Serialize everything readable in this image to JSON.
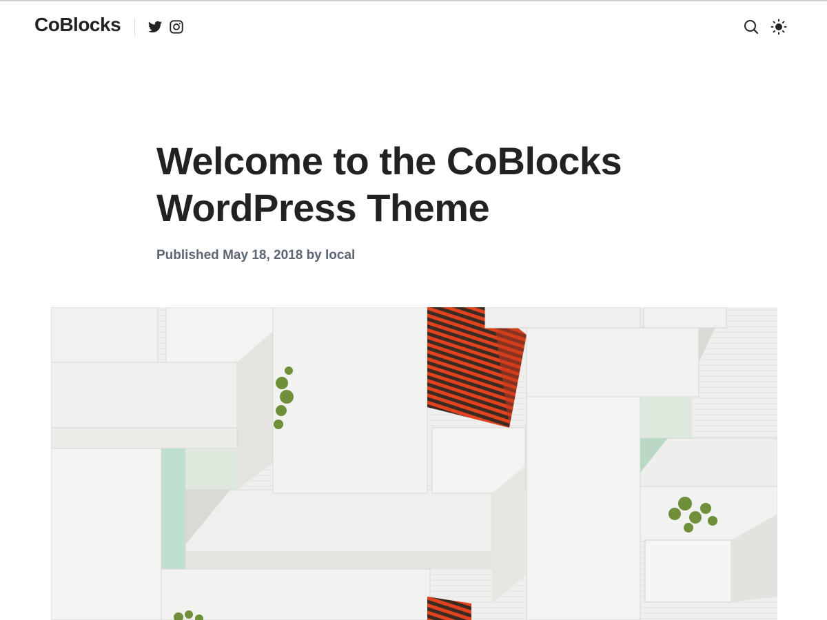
{
  "site": {
    "title": "CoBlocks",
    "social": [
      {
        "name": "twitter-icon"
      },
      {
        "name": "instagram-icon"
      }
    ]
  },
  "header": {
    "search_icon": "search-icon",
    "theme_icon": "sun-icon"
  },
  "post": {
    "title": "Welcome to the CoBlocks WordPress Theme",
    "meta": {
      "published_label": "Published",
      "date": "May 18, 2018",
      "by_label": "by",
      "author": "local"
    }
  },
  "colors": {
    "text": "#222222",
    "meta": "#5b6672",
    "accent_awning": "#e2431f",
    "wall": "#ececea",
    "plant": "#6f8f3a"
  }
}
